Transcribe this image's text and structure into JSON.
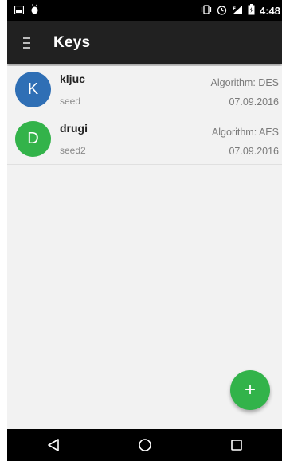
{
  "status_bar": {
    "time": "4:48",
    "icons": [
      "screenshot-icon",
      "android-debug-icon",
      "vibrate-icon",
      "alarm-icon",
      "signal-icon",
      "battery-icon"
    ]
  },
  "app_bar": {
    "title": "Keys",
    "menu_icon": "hamburger-icon"
  },
  "keys": [
    {
      "initial": "K",
      "name": "kljuc",
      "seed": "seed",
      "algorithm": "Algorithm:  DES",
      "date": "07.09.2016",
      "color": "#2f6fb5"
    },
    {
      "initial": "D",
      "name": "drugi",
      "seed": "seed2",
      "algorithm": "Algorithm:  AES",
      "date": "07.09.2016",
      "color": "#33b34a"
    }
  ],
  "fab": {
    "label": "+",
    "color": "#32b34a"
  },
  "nav_bar": {
    "buttons": [
      "back-icon",
      "home-icon",
      "recents-icon"
    ]
  },
  "colors": {
    "app_bar": "#212121",
    "background": "#f2f2f2",
    "status_bar": "#000000"
  }
}
